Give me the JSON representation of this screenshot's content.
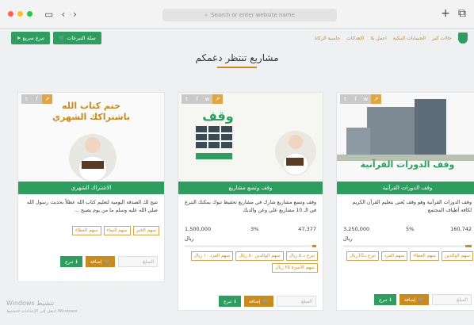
{
  "browser": {
    "address_placeholder": "Search or enter website name",
    "back": "‹",
    "forward": "›",
    "new_tab": "+"
  },
  "nav": {
    "links": [
      "حالات البر",
      "الحسابات البنكية",
      "اعمل بلا",
      "الإهدائات",
      "حاسبة الزكاة"
    ],
    "cart_button": "سلة التبرعات",
    "quick_button": "تبرع سريع"
  },
  "section_title": "مشاريع تنتظر دعمكم",
  "cards": [
    {
      "media_text": "وقف الدورات القرآنية",
      "title": "وقف الدورات القرآنية",
      "description": "وقف الدورات القرآنية وهو وقف يُعنى بتعليم القرآن الكريم لكافة أطياف المجتمع",
      "collected": "160,742",
      "percent": "5%",
      "target": "3,250,000",
      "target_unit": "ريال",
      "progress": 0.05,
      "chips": [
        "سهم الوالدين",
        "سهم العطاء",
        "سهم الفرد",
        "تبرع بـ10ريال"
      ],
      "amount_placeholder": "المبلغ",
      "add_label": "إضافة",
      "donate_label": "تبرع"
    },
    {
      "media_text": "وقف",
      "title": "وقف وتسع مشاريع",
      "description": "وقف وتسع مشاريع شارك في مشاريع تحفيظ تبوك بمكنك التبرع في الـ 10 مشاريع على وعن والديك",
      "collected": "47,377",
      "percent": "3%",
      "target": "1,500,000",
      "target_unit": "ريال",
      "progress": 0.03,
      "chips": [
        "تبرع بـ ٥ ريال",
        "سهم الوالدين ٥٠ ريال",
        "سهم الفرد ١٠ ريال",
        "سهم الأسرة ٢٥ ريال"
      ],
      "amount_placeholder": "المبلغ",
      "add_label": "إضافة",
      "donate_label": "تبرع"
    },
    {
      "media_text": "ختم كتاب الله باشتراكك الشهري",
      "title": "الاشتراك الشهري",
      "description": "تتيح لك الصدقة اليومية لتعليم كتاب الله عطلاً بحديث رسول الله صلى الله عليه وسلم ما من يوم يصبح ...",
      "chips": [
        "سهم الخير",
        "سهم النماء",
        "سهم العطاء"
      ],
      "amount_placeholder": "المبلغ",
      "add_label": "إضافة",
      "donate_label": "تبرع"
    }
  ],
  "watermark": {
    "line1": "Windows تنشيط",
    "line2": "انتقل إلى الإعدادات لتنشيط Windows"
  },
  "colors": {
    "green": "#2e9d5f",
    "gold": "#c98b1e"
  }
}
